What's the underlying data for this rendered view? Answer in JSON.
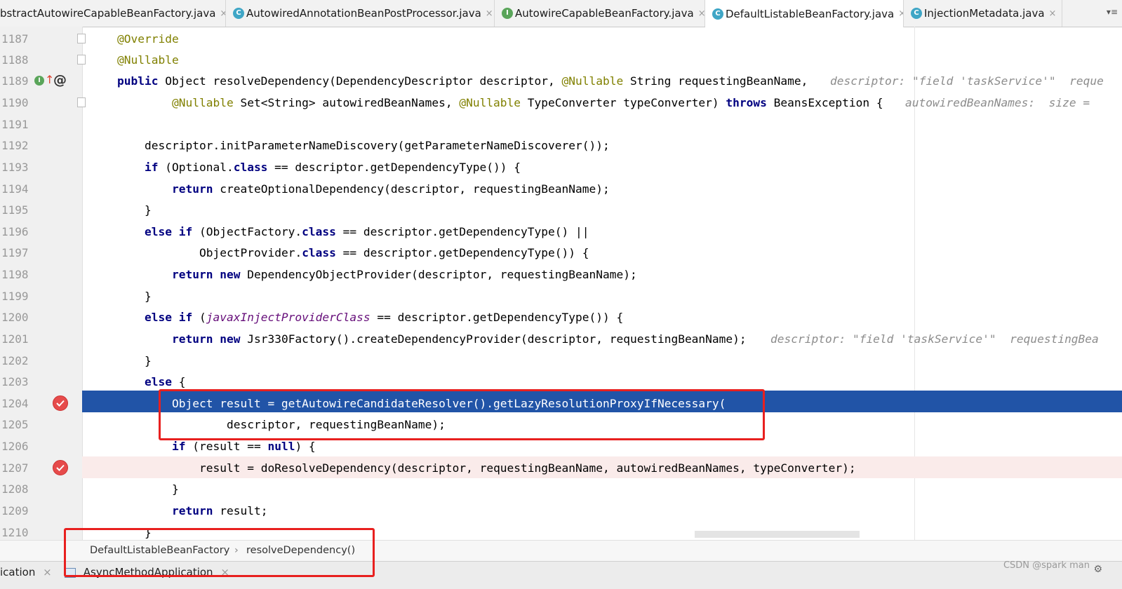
{
  "tabs": [
    {
      "label": "AbstractAutowireCapableBeanFactory.java",
      "display": "bstractAutowireCapableBeanFactory.java",
      "icon": "none",
      "active": false
    },
    {
      "label": "AutowiredAnnotationBeanPostProcessor.java",
      "icon": "class",
      "active": false
    },
    {
      "label": "AutowireCapableBeanFactory.java",
      "icon": "interface",
      "active": false
    },
    {
      "label": "DefaultListableBeanFactory.java",
      "icon": "class",
      "active": true
    },
    {
      "label": "InjectionMetadata.java",
      "icon": "class",
      "active": false
    }
  ],
  "close_glyph": "×",
  "tab_menu": "▾≡",
  "code": {
    "lines": [
      {
        "num": "1187",
        "text": "@Override"
      },
      {
        "num": "1188",
        "text": "@Nullable"
      },
      {
        "num": "1189",
        "text": "public Object resolveDependency(DependencyDescriptor descriptor, @Nullable String requestingBeanName,",
        "hint": "descriptor: \"field 'taskService'\"  reque"
      },
      {
        "num": "1190",
        "text": "@Nullable Set<String> autowiredBeanNames, @Nullable TypeConverter typeConverter) throws BeansException {",
        "hint": "autowiredBeanNames:  size ="
      },
      {
        "num": "1191",
        "text": ""
      },
      {
        "num": "1192",
        "text": "descriptor.initParameterNameDiscovery(getParameterNameDiscoverer());"
      },
      {
        "num": "1193",
        "text": "if (Optional.class == descriptor.getDependencyType()) {"
      },
      {
        "num": "1194",
        "text": "return createOptionalDependency(descriptor, requestingBeanName);"
      },
      {
        "num": "1195",
        "text": "}"
      },
      {
        "num": "1196",
        "text": "else if (ObjectFactory.class == descriptor.getDependencyType() ||"
      },
      {
        "num": "1197",
        "text": "ObjectProvider.class == descriptor.getDependencyType()) {"
      },
      {
        "num": "1198",
        "text": "return new DependencyObjectProvider(descriptor, requestingBeanName);"
      },
      {
        "num": "1199",
        "text": "}"
      },
      {
        "num": "1200",
        "text": "else if (javaxInjectProviderClass == descriptor.getDependencyType()) {"
      },
      {
        "num": "1201",
        "text": "return new Jsr330Factory().createDependencyProvider(descriptor, requestingBeanName);",
        "hint": "descriptor: \"field 'taskService'\"  requestingBea"
      },
      {
        "num": "1202",
        "text": "}"
      },
      {
        "num": "1203",
        "text": "else {"
      },
      {
        "num": "1204",
        "text": "Object result = getAutowireCandidateResolver().getLazyResolutionProxyIfNecessary("
      },
      {
        "num": "1205",
        "text": "descriptor, requestingBeanName);"
      },
      {
        "num": "1206",
        "text": "if (result == null) {"
      },
      {
        "num": "1207",
        "text": "result = doResolveDependency(descriptor, requestingBeanName, autowiredBeanNames, typeConverter);"
      },
      {
        "num": "1208",
        "text": "}"
      },
      {
        "num": "1209",
        "text": "return result;"
      },
      {
        "num": "1210",
        "text": "}"
      }
    ]
  },
  "gutter": {
    "override_marker": "I",
    "at_marker": "@"
  },
  "breadcrumb": {
    "class_name": "DefaultListableBeanFactory",
    "separator": "›",
    "method_name": "resolveDependency()"
  },
  "run_tabs": [
    {
      "label": "ication",
      "close": "×"
    },
    {
      "label": "AsyncMethodApplication",
      "close": "×"
    }
  ],
  "watermark": "CSDN @spark man",
  "colors": {
    "highlight_line": "#2154a7",
    "breakpoint": "#e64b4b",
    "breakpoint_line": "#faebea",
    "keyword": "#000080",
    "annotation": "#808000",
    "annotation_box": "#e8201f"
  }
}
